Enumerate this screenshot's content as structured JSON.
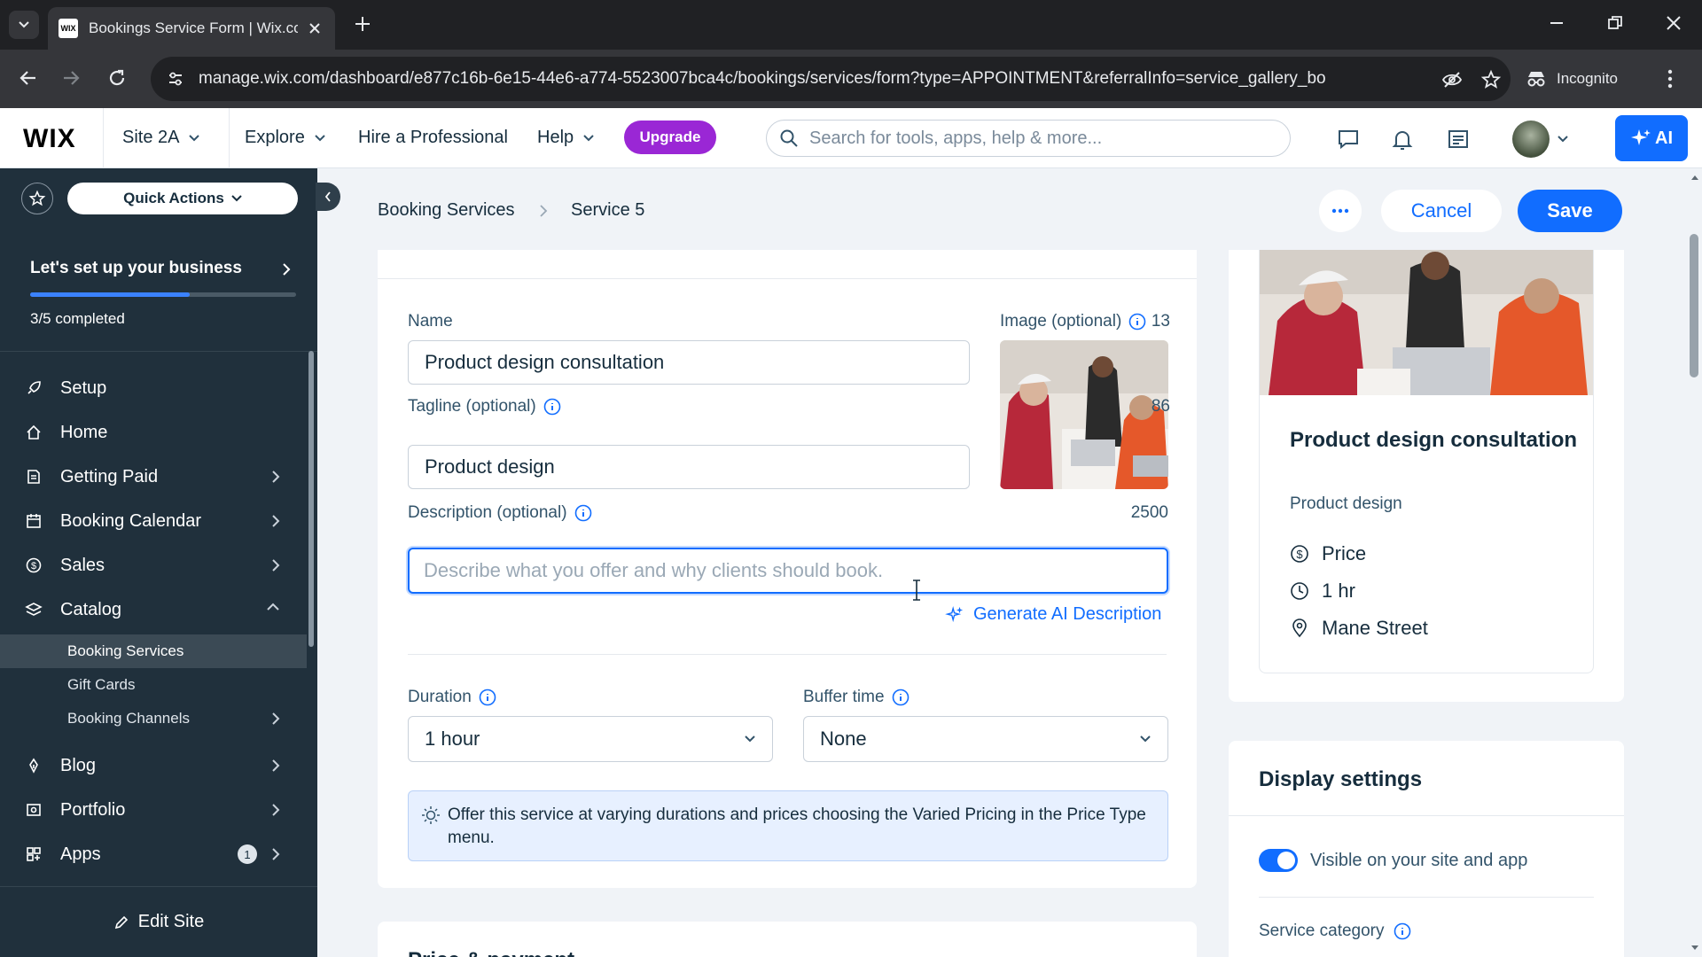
{
  "browser": {
    "tab_title": "Bookings Service Form | Wix.com",
    "favicon_text": "WIX",
    "url": "manage.wix.com/dashboard/e877c16b-6e15-44e6-a774-5523007bca4c/bookings/services/form?type=APPOINTMENT&referralInfo=service_gallery_bo",
    "incognito_label": "Incognito"
  },
  "topbar": {
    "logo": "WIX",
    "site_name": "Site 2A",
    "explore": "Explore",
    "hire": "Hire a Professional",
    "help": "Help",
    "upgrade": "Upgrade",
    "search_placeholder": "Search for tools, apps, help & more...",
    "ai_label": "AI"
  },
  "sidebar": {
    "quick_actions": "Quick Actions",
    "setup_title": "Let's set up your business",
    "progress_text": "3/5 completed",
    "progress_fraction": 0.6,
    "items": [
      {
        "label": "Setup",
        "icon": "rocket-icon"
      },
      {
        "label": "Home",
        "icon": "home-icon"
      },
      {
        "label": "Getting Paid",
        "icon": "receipt-icon"
      },
      {
        "label": "Booking Calendar",
        "icon": "calendar-icon"
      },
      {
        "label": "Sales",
        "icon": "dollar-icon"
      },
      {
        "label": "Catalog",
        "icon": "catalog-icon"
      }
    ],
    "catalog_sub": [
      "Booking Services",
      "Gift Cards",
      "Booking Channels"
    ],
    "items_after": [
      {
        "label": "Blog",
        "icon": "pen-icon"
      },
      {
        "label": "Portfolio",
        "icon": "portfolio-icon"
      },
      {
        "label": "Apps",
        "icon": "apps-icon",
        "badge": "1"
      }
    ],
    "edit_site": "Edit Site"
  },
  "header": {
    "breadcrumb_parent": "Booking Services",
    "breadcrumb_current": "Service 5",
    "cancel": "Cancel",
    "save": "Save"
  },
  "form": {
    "name_label": "Name",
    "name_count": "13",
    "name_value": "Product design consultation",
    "image_label": "Image (optional)",
    "tagline_label": "Tagline (optional)",
    "tagline_count": "86",
    "tagline_value": "Product design",
    "description_label": "Description (optional)",
    "description_count": "2500",
    "description_placeholder": "Describe what you offer and why clients should book.",
    "generate_ai": "Generate AI Description",
    "duration_label": "Duration",
    "duration_value": "1 hour",
    "buffer_label": "Buffer time",
    "buffer_value": "None",
    "info_text": "Offer this service at varying durations and prices choosing the Varied Pricing in the Price Type menu.",
    "price_section_title": "Price & payment"
  },
  "preview": {
    "title": "Product design consultation",
    "tagline": "Product design",
    "price": "Price",
    "duration": "1 hr",
    "location": "Mane Street"
  },
  "display_settings": {
    "title": "Display settings",
    "visible_label": "Visible on your site and app",
    "visible_on": true,
    "service_category_label": "Service category"
  },
  "colors": {
    "accent": "#116dff",
    "upgrade": "#9a27d5",
    "sidebar_bg": "#20303c",
    "chrome_bg": "#202124"
  }
}
